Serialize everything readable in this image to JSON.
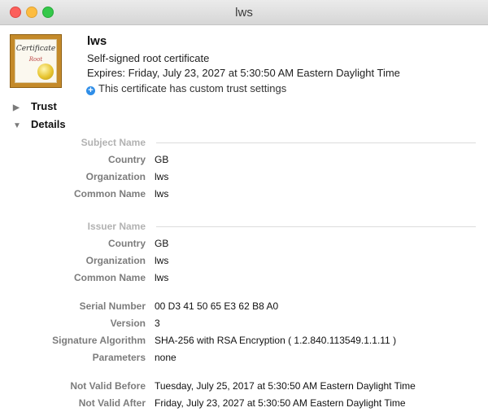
{
  "window": {
    "title": "lws"
  },
  "header": {
    "icon": "certificate-icon",
    "icon_word": "Certificate",
    "icon_subword": "Root",
    "name": "lws",
    "type": "Self-signed root certificate",
    "expires": "Expires: Friday, July 23, 2027 at 5:30:50 AM Eastern Daylight Time",
    "trust_note": "This certificate has custom trust settings",
    "info_glyph": "+"
  },
  "sections": {
    "trust": {
      "label": "Trust",
      "expanded": false
    },
    "details": {
      "label": "Details",
      "expanded": true
    }
  },
  "subject": {
    "heading": "Subject Name",
    "rows": [
      {
        "label": "Country",
        "value": "GB"
      },
      {
        "label": "Organization",
        "value": "lws"
      },
      {
        "label": "Common Name",
        "value": "lws"
      }
    ]
  },
  "issuer": {
    "heading": "Issuer Name",
    "rows": [
      {
        "label": "Country",
        "value": "GB"
      },
      {
        "label": "Organization",
        "value": "lws"
      },
      {
        "label": "Common Name",
        "value": "lws"
      }
    ]
  },
  "general": {
    "rows": [
      {
        "label": "Serial Number",
        "value": "00 D3 41 50 65 E3 62 B8 A0"
      },
      {
        "label": "Version",
        "value": "3"
      },
      {
        "label": "Signature Algorithm",
        "value": "SHA-256 with RSA Encryption ( 1.2.840.113549.1.1.11 )"
      },
      {
        "label": "Parameters",
        "value": "none"
      }
    ]
  },
  "validity": {
    "rows": [
      {
        "label": "Not Valid Before",
        "value": "Tuesday, July 25, 2017 at 5:30:50 AM Eastern Daylight Time"
      },
      {
        "label": "Not Valid After",
        "value": "Friday, July 23, 2027 at 5:30:50 AM Eastern Daylight Time"
      }
    ]
  },
  "colors": {
    "close": "#fc605c",
    "minimize": "#fdbc40",
    "maximize": "#34c84a",
    "info": "#2f8ee8"
  }
}
